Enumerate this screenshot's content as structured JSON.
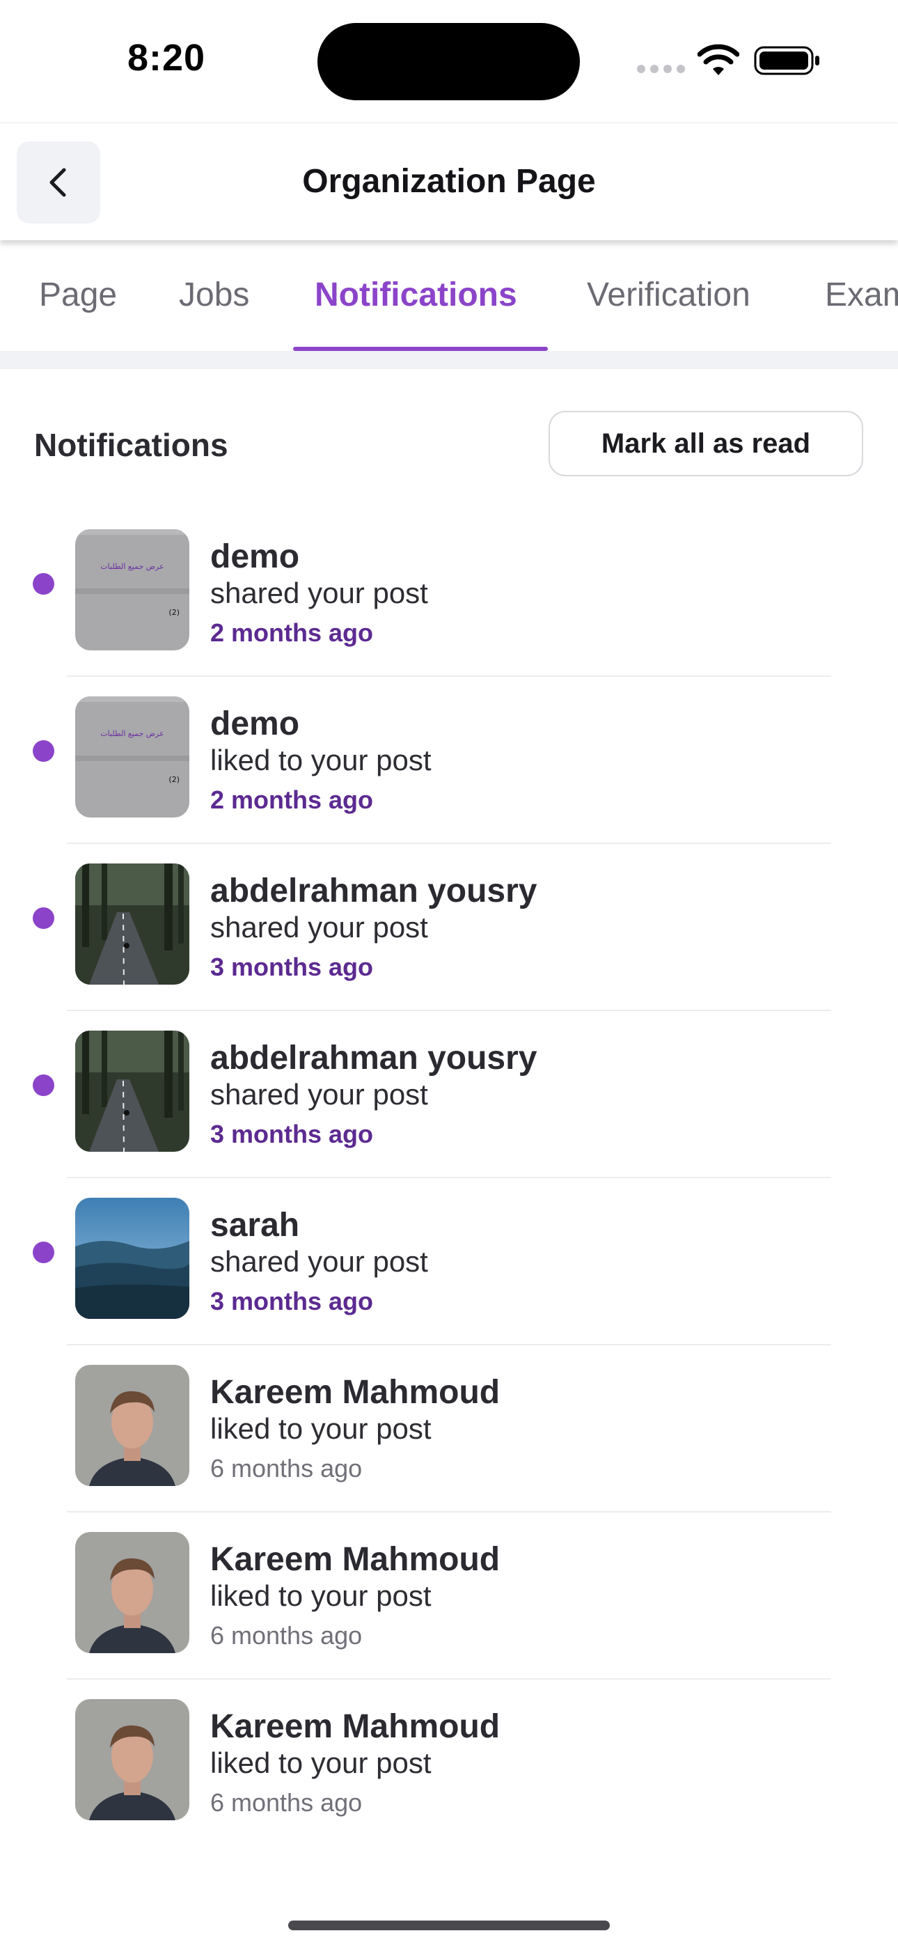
{
  "status_bar": {
    "time": "8:20"
  },
  "header": {
    "title": "Organization Page"
  },
  "tabs": [
    {
      "label": "Page",
      "active": false
    },
    {
      "label": "Jobs",
      "active": false
    },
    {
      "label": "Notifications",
      "active": true
    },
    {
      "label": "Verification",
      "active": false
    },
    {
      "label": "Exam",
      "active": false
    }
  ],
  "section": {
    "title": "Notifications",
    "mark_all_label": "Mark all as read"
  },
  "notifications": [
    {
      "name": "demo",
      "action": "shared your post",
      "time_ago": "2 months ago",
      "unread": true,
      "thumbnail": "document-screenshot",
      "thumb_text_1": "عرض جميع الطلبات",
      "thumb_text_2": "(2)"
    },
    {
      "name": "demo",
      "action": "liked to your post",
      "time_ago": "2 months ago",
      "unread": true,
      "thumbnail": "document-screenshot",
      "thumb_text_1": "عرض جميع الطلبات",
      "thumb_text_2": "(2)"
    },
    {
      "name": "abdelrahman yousry",
      "action": "shared your post",
      "time_ago": "3 months ago",
      "unread": true,
      "thumbnail": "forest-road-photo"
    },
    {
      "name": "abdelrahman yousry",
      "action": "shared your post",
      "time_ago": "3 months ago",
      "unread": true,
      "thumbnail": "forest-road-photo"
    },
    {
      "name": "sarah",
      "action": "shared your post",
      "time_ago": "3 months ago",
      "unread": true,
      "thumbnail": "misty-landscape-photo"
    },
    {
      "name": "Kareem Mahmoud",
      "action": "liked to your post",
      "time_ago": "6 months ago",
      "unread": false,
      "thumbnail": "portrait-photo"
    },
    {
      "name": "Kareem Mahmoud",
      "action": "liked to your post",
      "time_ago": "6 months ago",
      "unread": false,
      "thumbnail": "portrait-photo"
    },
    {
      "name": "Kareem Mahmoud",
      "action": "liked to your post",
      "time_ago": "6 months ago",
      "unread": false,
      "thumbnail": "portrait-photo"
    }
  ],
  "colors": {
    "accent": "#8b44c9",
    "time_unread": "#5c2a91",
    "time_read": "#707078"
  }
}
